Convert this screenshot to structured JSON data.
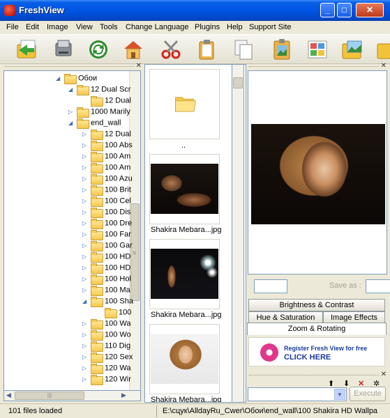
{
  "window": {
    "title": "FreshView"
  },
  "menu": [
    "File",
    "Edit",
    "Image",
    "View",
    "Tools",
    "Change Language",
    "Plugins",
    "Help",
    "Support Site"
  ],
  "toolbar": [
    {
      "name": "open-folder-icon"
    },
    {
      "name": "scanner-icon"
    },
    {
      "name": "refresh-icon"
    },
    {
      "name": "home-icon"
    },
    {
      "name": "cut-icon"
    },
    {
      "name": "paste-icon"
    },
    {
      "name": "copy-icon"
    },
    {
      "name": "clipboard-image-icon"
    },
    {
      "name": "mosaic-icon"
    },
    {
      "name": "images-folder-icon"
    }
  ],
  "tree": {
    "items": [
      {
        "label": "Обои",
        "depth": 0,
        "expanded": true
      },
      {
        "label": "12 Dual Scr",
        "depth": 1,
        "expanded": true
      },
      {
        "label": "12 Dual",
        "depth": 2,
        "expanded": false,
        "leaf": true
      },
      {
        "label": "1000 Marily",
        "depth": 1,
        "expanded": false
      },
      {
        "label": "end_wall",
        "depth": 1,
        "expanded": true
      },
      {
        "label": "12 Dual",
        "depth": 2
      },
      {
        "label": "100 Abs",
        "depth": 2
      },
      {
        "label": "100 Am",
        "depth": 2
      },
      {
        "label": "100 Am",
        "depth": 2
      },
      {
        "label": "100 Azu",
        "depth": 2
      },
      {
        "label": "100 Brit",
        "depth": 2
      },
      {
        "label": "100 Cel",
        "depth": 2
      },
      {
        "label": "100 Dis",
        "depth": 2
      },
      {
        "label": "100 Dre",
        "depth": 2
      },
      {
        "label": "100 Far",
        "depth": 2
      },
      {
        "label": "100 Gar",
        "depth": 2
      },
      {
        "label": "100 HD",
        "depth": 2
      },
      {
        "label": "100 HD",
        "depth": 2
      },
      {
        "label": "100 Hol",
        "depth": 2
      },
      {
        "label": "100 Ma",
        "depth": 2
      },
      {
        "label": "100 Sha",
        "depth": 2,
        "expanded": true
      },
      {
        "label": "100",
        "depth": 3,
        "leaf": true
      },
      {
        "label": "100 Wa",
        "depth": 2
      },
      {
        "label": "100 Wo",
        "depth": 2
      },
      {
        "label": "110 Dig",
        "depth": 2
      },
      {
        "label": "120 Sex",
        "depth": 2
      },
      {
        "label": "120 Wa",
        "depth": 2
      },
      {
        "label": "120 Wir",
        "depth": 2
      }
    ]
  },
  "thumbnails": {
    "parent_label": "..",
    "items": [
      {
        "caption": "Shakira Mebara...jpg"
      },
      {
        "caption": "Shakira Mebara...jpg"
      },
      {
        "caption": "Shakira Mebara...jpg"
      }
    ]
  },
  "editor": {
    "save_as_label": "Save as :",
    "tabs": [
      "Brightness & Contrast",
      "Hue & Saturation",
      "Image Effects",
      "Zoom & Rotating"
    ],
    "banner_line1": "Register Fresh View for free",
    "banner_line2": "CLICK HERE",
    "execute_label": "Execute"
  },
  "status": {
    "files": "101 files loaded",
    "path": "E:\\сцук\\AlldayRu_Cwer\\Обои\\end_wall\\100 Shakira HD Wallpa"
  }
}
